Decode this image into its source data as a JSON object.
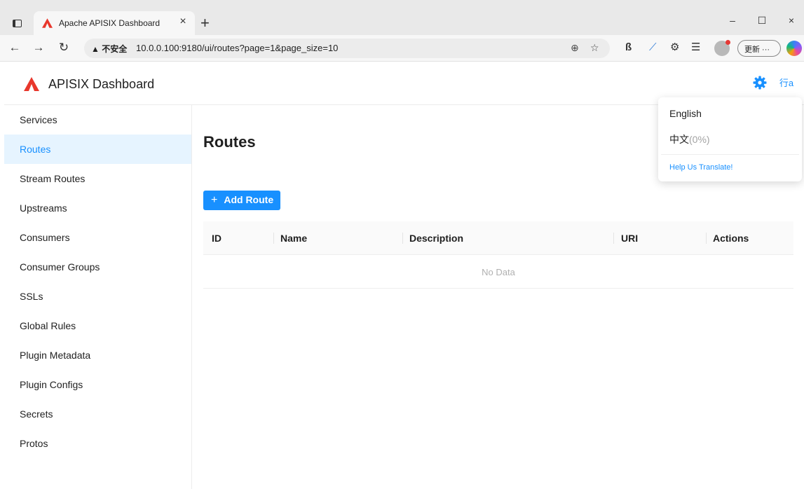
{
  "browser": {
    "tab_title": "Apache APISIX Dashboard",
    "tab_close": "×",
    "new_tab": "+",
    "win_minimize": "–",
    "win_maximize": "☐",
    "win_close": "×",
    "security_warning": "▲ 不安全",
    "url": "10.0.0.100:9180/ui/routes?page=1&page_size=10",
    "update_label": "更新 ···",
    "brand_color": "#e8372c"
  },
  "app": {
    "title": "APISIX Dashboard",
    "accent_color": "#1890ff",
    "lang_icon_glyph": "行a"
  },
  "sidebar": {
    "items": [
      {
        "label": "Services"
      },
      {
        "label": "Routes"
      },
      {
        "label": "Stream Routes"
      },
      {
        "label": "Upstreams"
      },
      {
        "label": "Consumers"
      },
      {
        "label": "Consumer Groups"
      },
      {
        "label": "SSLs"
      },
      {
        "label": "Global Rules"
      },
      {
        "label": "Plugin Metadata"
      },
      {
        "label": "Plugin Configs"
      },
      {
        "label": "Secrets"
      },
      {
        "label": "Protos"
      }
    ],
    "active": "Routes"
  },
  "main": {
    "title": "Routes",
    "add_button": "Add Route",
    "table": {
      "columns": [
        "ID",
        "Name",
        "Description",
        "URI",
        "Actions"
      ],
      "empty_text": "No Data"
    }
  },
  "language_menu": {
    "options": [
      {
        "label": "English",
        "suffix": ""
      },
      {
        "label": "中文",
        "suffix": "(0%)"
      }
    ],
    "help_link": "Help Us Translate!"
  }
}
